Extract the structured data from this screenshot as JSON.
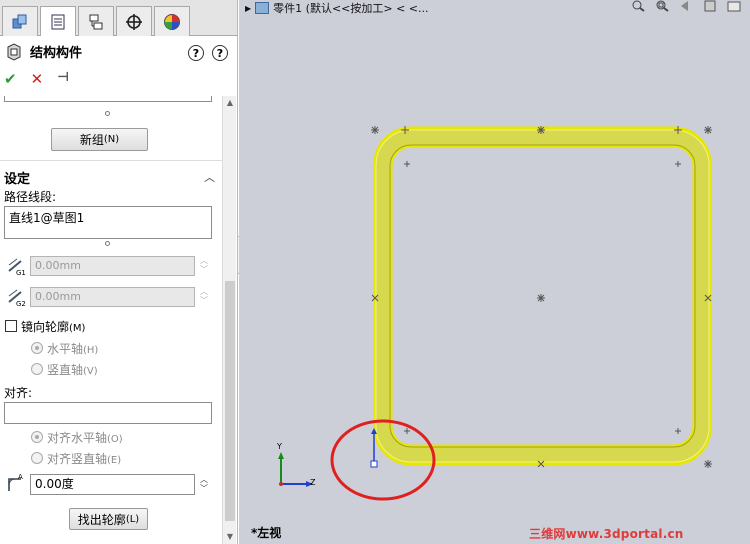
{
  "tabs": [
    {
      "icon": "feature-manager-icon"
    },
    {
      "icon": "property-manager-icon"
    },
    {
      "icon": "configuration-manager-icon"
    },
    {
      "icon": "dimxpert-icon"
    },
    {
      "icon": "display-manager-icon"
    }
  ],
  "panel": {
    "title": "结构构件",
    "help1": "?",
    "help2": "?"
  },
  "new_group_button": {
    "label": "新组",
    "shortcut": "(N)"
  },
  "settings": {
    "section_title": "设定",
    "path_segments_label": "路径线段:",
    "path_segment_item": "直线1@草图1",
    "offset1": {
      "sub": "G1",
      "value": "0.00mm"
    },
    "offset2": {
      "sub": "G2",
      "value": "0.00mm"
    },
    "mirror_profile": {
      "label": "镜向轮廓",
      "shortcut": "(M)"
    },
    "horizontal_axis": {
      "label": "水平轴",
      "shortcut": "(H)"
    },
    "vertical_axis": {
      "label": "竖直轴",
      "shortcut": "(V)"
    },
    "align_label": "对齐:",
    "align_horizontal": {
      "label": "对齐水平轴",
      "shortcut": "(O)"
    },
    "align_vertical": {
      "label": "对齐竖直轴",
      "shortcut": "(E)"
    },
    "rotation_angle": {
      "sub": "A",
      "value": "0.00度"
    },
    "locate_profile_button": {
      "label": "找出轮廓",
      "shortcut": "(L)"
    }
  },
  "graphics": {
    "breadcrumb": "零件1  (默认<<按加工> < <...",
    "view_name": "*左视",
    "axis_y": "Y",
    "axis_z": "Z",
    "watermark": "三维网www.3dportal.cn"
  },
  "colors": {
    "profile_fill": "#e8e85a",
    "profile_edge": "#c8c800",
    "background": "#cdcfd8",
    "highlight_circle": "#e02020"
  }
}
